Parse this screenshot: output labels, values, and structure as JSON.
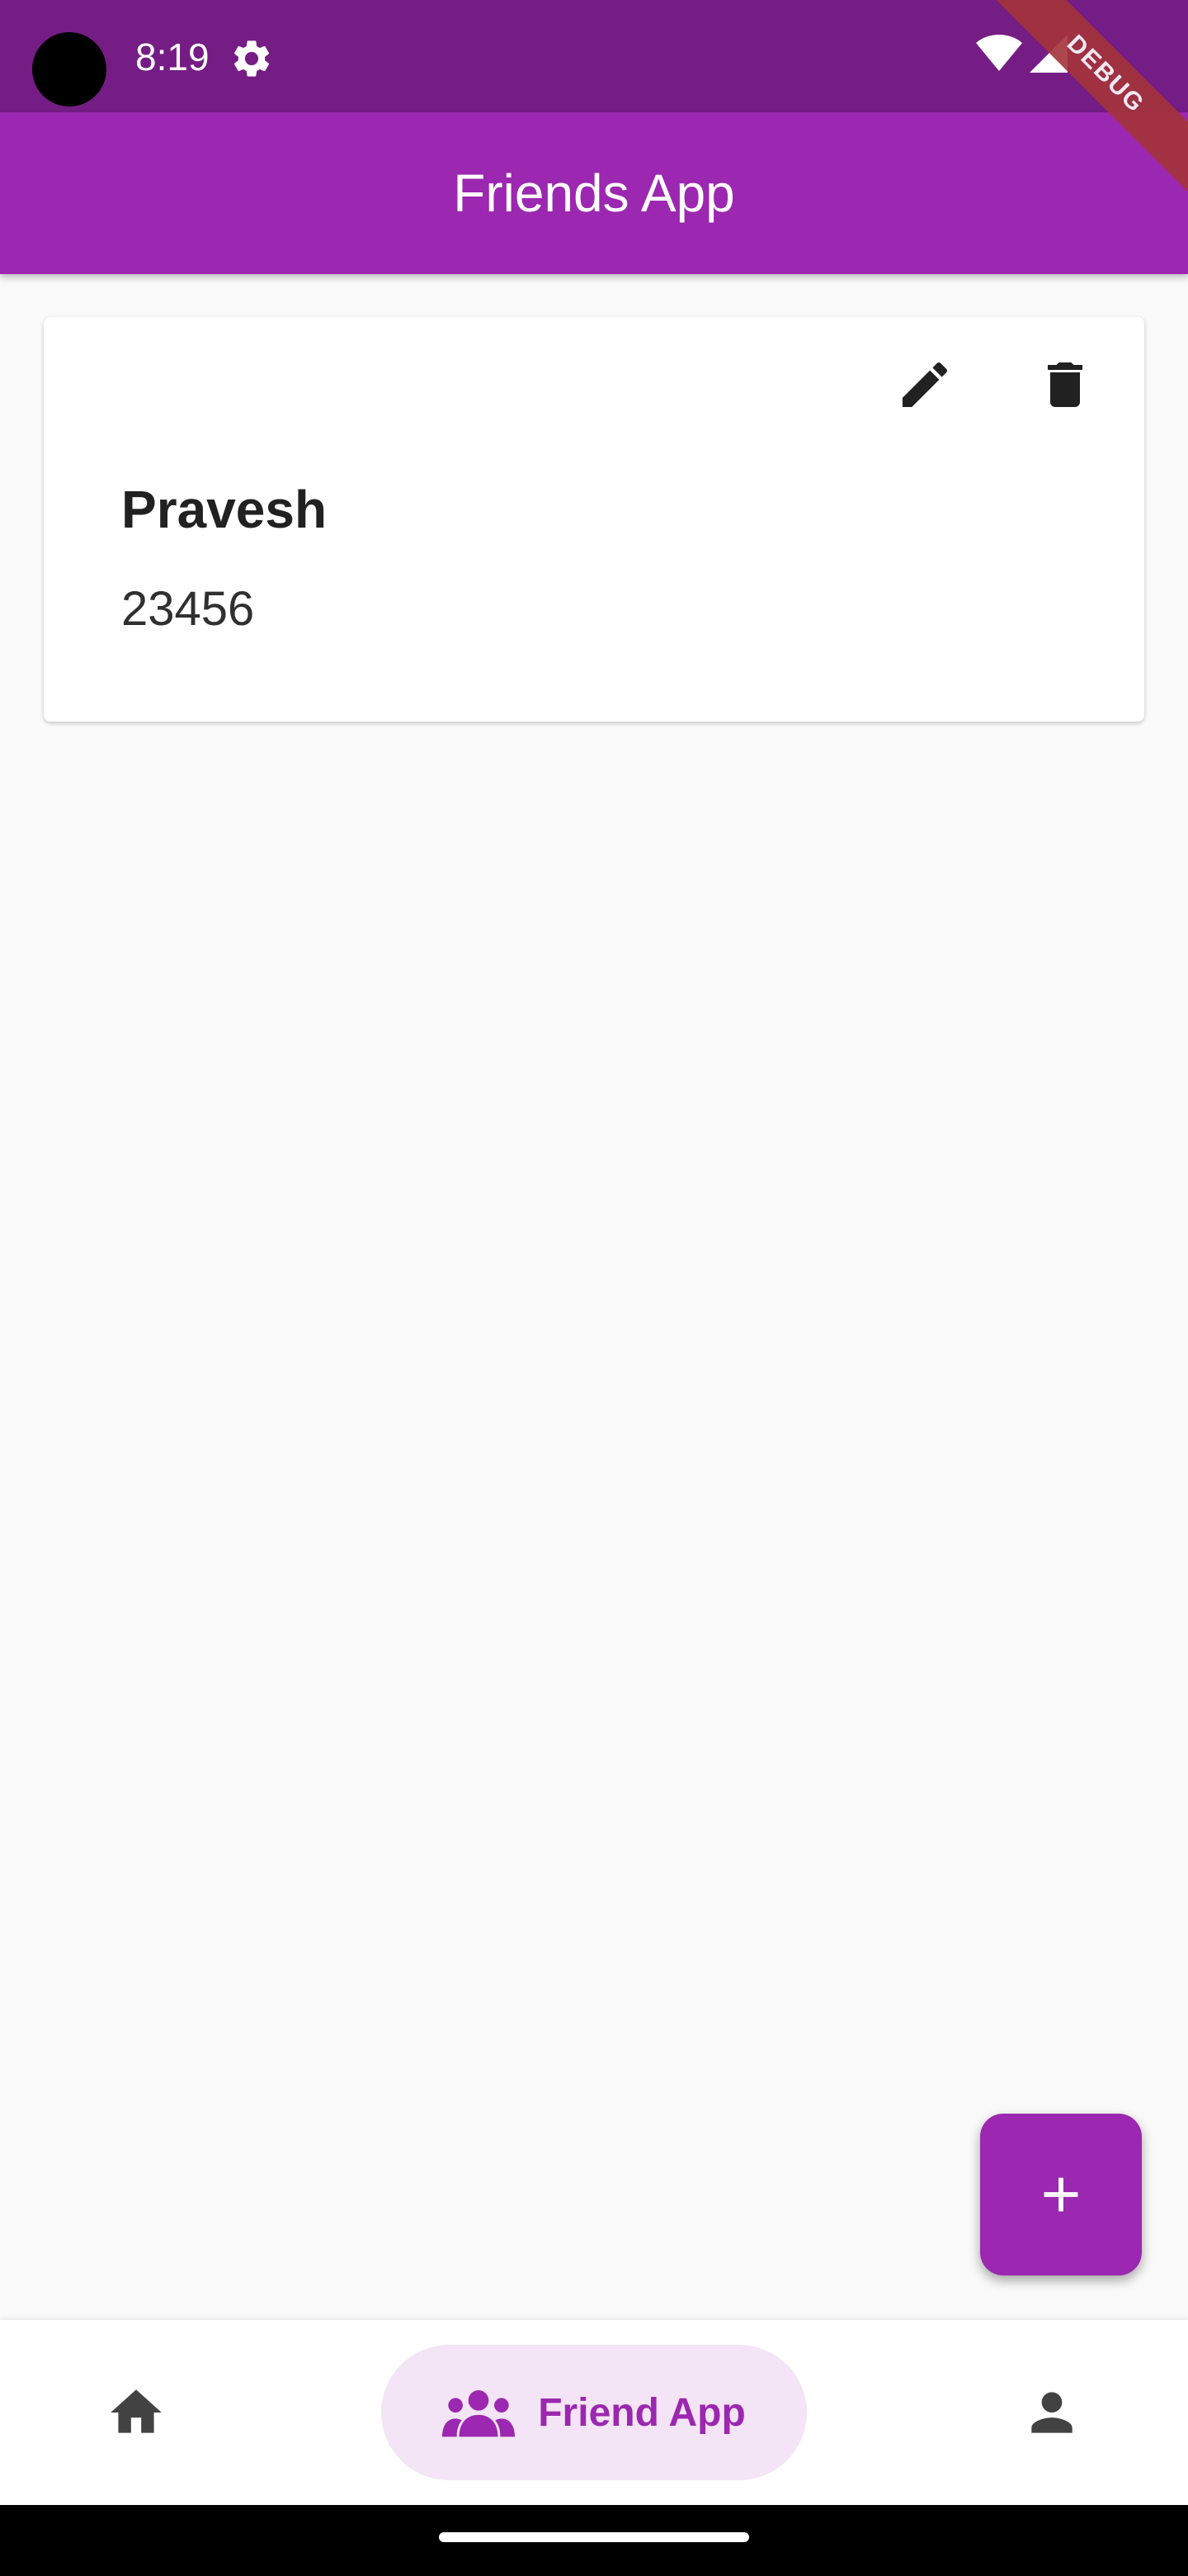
{
  "status_bar": {
    "time": "8:19",
    "icons": [
      "gear-icon",
      "wifi-icon",
      "signal-icon"
    ]
  },
  "debug_banner": "DEBUG",
  "app_bar": {
    "title": "Friends App",
    "color": "#9c27b0"
  },
  "friends": [
    {
      "name": "Pravesh",
      "phone": "23456",
      "actions": [
        "edit-icon",
        "delete-icon"
      ]
    }
  ],
  "fab": {
    "icon": "add-icon"
  },
  "bottom_nav": {
    "items": [
      {
        "icon": "home-icon",
        "label": ""
      },
      {
        "icon": "group-icon",
        "label": "Friend App",
        "selected": true
      },
      {
        "icon": "person-icon",
        "label": ""
      }
    ],
    "selected_color": "#9c27b0"
  }
}
